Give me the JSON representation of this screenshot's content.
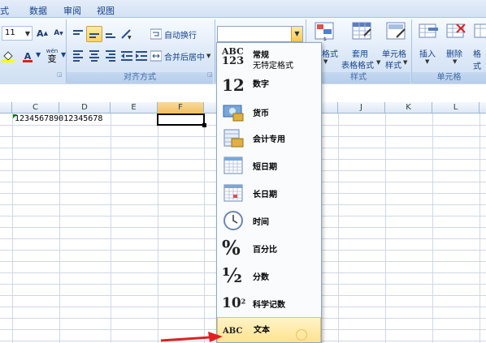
{
  "menu": {
    "tabs": [
      {
        "label": "式"
      },
      {
        "label": "数据"
      },
      {
        "label": "审阅"
      },
      {
        "label": "视图"
      }
    ]
  },
  "ribbon": {
    "font_size": "11",
    "font_grow": "A",
    "font_shrink": "A",
    "font_color_label": "A",
    "phonetic_label": "wén",
    "phonetic_char": "变",
    "wrap_text": "自动换行",
    "merge_center": "合并后居中",
    "alignment_group": "对齐方式",
    "styles_group": "样式",
    "cells_group": "单元格",
    "cond_format_suffix": "格式",
    "table_format": "套用",
    "table_format_2": "表格格式",
    "cell_style": "单元格",
    "cell_style_2": "样式",
    "insert": "插入",
    "delete": "删除",
    "format": "格式"
  },
  "columns": [
    "C",
    "D",
    "E",
    "F",
    "J",
    "K",
    "L"
  ],
  "selected_column": "F",
  "cells": {
    "c1_value": "123456789012345678"
  },
  "number_formats": [
    {
      "icon": "abc123-icon",
      "label": "常规",
      "sub": "无特定格式"
    },
    {
      "icon": "number-12-icon",
      "label": "数字",
      "sub": ""
    },
    {
      "icon": "currency-icon",
      "label": "货币",
      "sub": ""
    },
    {
      "icon": "accounting-icon",
      "label": "会计专用",
      "sub": ""
    },
    {
      "icon": "short-date-icon",
      "label": "短日期",
      "sub": ""
    },
    {
      "icon": "long-date-icon",
      "label": "长日期",
      "sub": ""
    },
    {
      "icon": "clock-icon",
      "label": "时间",
      "sub": ""
    },
    {
      "icon": "percent-icon",
      "label": "百分比",
      "sub": ""
    },
    {
      "icon": "fraction-icon",
      "label": "分数",
      "sub": ""
    },
    {
      "icon": "scientific-icon",
      "label": "科学记数",
      "sub": ""
    },
    {
      "icon": "text-abc-icon",
      "label": "文本",
      "sub": ""
    }
  ],
  "icon_text": {
    "abc": "ABC",
    "n123": "123",
    "n12": "12",
    "percent": "%",
    "half": "½",
    "ten": "10",
    "exp": "2",
    "text_abc": "ABC"
  },
  "colors": {
    "accent_red": "#e02020",
    "hover": "#ffe28a",
    "ribbon_text": "#15428b"
  }
}
